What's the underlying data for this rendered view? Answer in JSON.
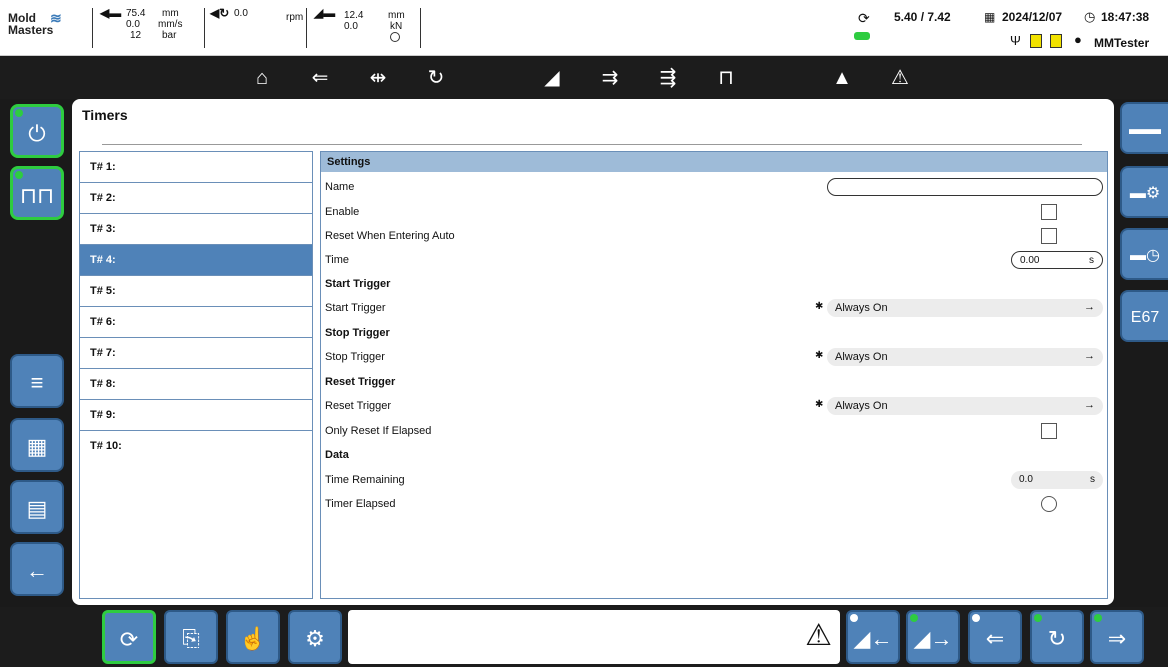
{
  "topbar": {
    "logo": "Mold Masters",
    "gauge1": {
      "icon": "injection-unit-icon",
      "v1": "75.4",
      "u1": "mm",
      "v2": "0.0",
      "u2": "mm/s",
      "v3": "12",
      "u3": "bar"
    },
    "gauge2": {
      "icon": "screw-rotate-icon",
      "v1": "0.0",
      "u1": "rpm"
    },
    "gauge3": {
      "icon": "clamp-icon",
      "v1": "12.4",
      "u1": "mm",
      "v2": "0.0",
      "u2": "kN"
    },
    "cycle_icon": "cycle-icon",
    "cycle_value": "5.40 / 7.42",
    "date": "2024/12/07",
    "time": "18:47:38",
    "user": "MMTester"
  },
  "toolbar": {
    "icons": [
      "home-icon",
      "injection-icon",
      "hold-icon",
      "plasticize-icon",
      "mold-close-icon",
      "ejector-icon",
      "core-icon",
      "heating-icon",
      "chart-icon",
      "warning-icon"
    ]
  },
  "page": {
    "title": "Timers"
  },
  "timers": [
    {
      "label": "T# 1:"
    },
    {
      "label": "T# 2:"
    },
    {
      "label": "T# 3:"
    },
    {
      "label": "T# 4:"
    },
    {
      "label": "T# 5:"
    },
    {
      "label": "T# 6:"
    },
    {
      "label": "T# 7:"
    },
    {
      "label": "T# 8:"
    },
    {
      "label": "T# 9:"
    },
    {
      "label": "T# 10:"
    }
  ],
  "selected_timer": 3,
  "settings": {
    "header": "Settings",
    "name_label": "Name",
    "enable_label": "Enable",
    "reset_auto_label": "Reset When Entering Auto",
    "time_label": "Time",
    "time_value": "0.00",
    "time_unit": "s",
    "start_trigger_section": "Start Trigger",
    "start_trigger_label": "Start Trigger",
    "start_trigger_value": "Always On",
    "stop_trigger_section": "Stop Trigger",
    "stop_trigger_label": "Stop Trigger",
    "stop_trigger_value": "Always On",
    "reset_trigger_section": "Reset Trigger",
    "reset_trigger_label": "Reset Trigger",
    "reset_trigger_value": "Always On",
    "only_reset_label": "Only Reset If Elapsed",
    "data_section": "Data",
    "time_remaining_label": "Time Remaining",
    "time_remaining_value": "0.0",
    "time_remaining_unit": "s",
    "timer_elapsed_label": "Timer Elapsed"
  },
  "right_buttons": [
    {
      "icon": "machine-icon"
    },
    {
      "icon": "machine-settings-icon"
    },
    {
      "icon": "machine-timer-icon"
    },
    {
      "label": "E67"
    }
  ],
  "colors": {
    "accent": "#4f82b8",
    "active": "#2ecc40",
    "header": "#9ebbd8"
  }
}
